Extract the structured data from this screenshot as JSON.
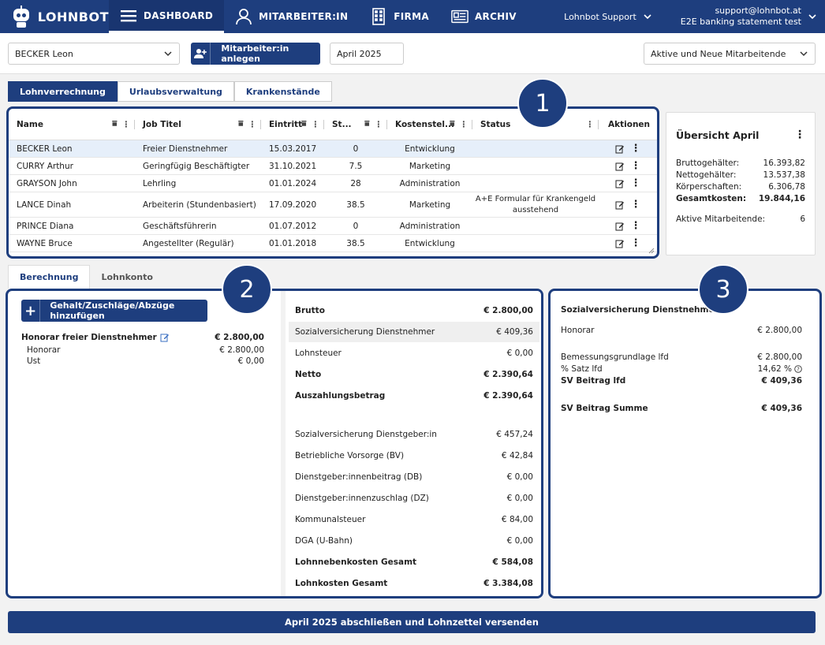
{
  "nav": {
    "logo": "LOHNBOT",
    "items": [
      {
        "label": "DASHBOARD",
        "icon": "menu-icon",
        "active": true
      },
      {
        "label": "MITARBEITER:IN",
        "icon": "user-icon",
        "active": false
      },
      {
        "label": "FIRMA",
        "icon": "building-icon",
        "active": false
      },
      {
        "label": "ARCHIV",
        "icon": "archive-icon",
        "active": false
      }
    ],
    "support": "Lohnbot Support",
    "account_email": "support@lohnbot.at",
    "account_name": "E2E banking statement test"
  },
  "toolbar": {
    "employee_select": "BECKER Leon",
    "add_employee": "Mitarbeiter:in anlegen",
    "month": "April 2025",
    "filter": "Aktive und Neue Mitarbeitende"
  },
  "tabs_top": [
    "Lohnverrechnung",
    "Urlaubsverwaltung",
    "Krankenstände"
  ],
  "table": {
    "headers": [
      "Name",
      "Job Titel",
      "Eintritt",
      "St...",
      "Kostenstel...",
      "Status",
      "Aktionen"
    ],
    "rows": [
      {
        "name": "BECKER Leon",
        "job": "Freier Dienstnehmer",
        "eintritt": "15.03.2017",
        "st": "0",
        "kst": "Entwicklung",
        "status": ""
      },
      {
        "name": "CURRY Arthur",
        "job": "Geringfügig Beschäftigter",
        "eintritt": "31.10.2021",
        "st": "7.5",
        "kst": "Marketing",
        "status": ""
      },
      {
        "name": "GRAYSON John",
        "job": "Lehrling",
        "eintritt": "01.01.2024",
        "st": "28",
        "kst": "Administration",
        "status": ""
      },
      {
        "name": "LANCE Dinah",
        "job": "Arbeiterin (Stundenbasiert)",
        "eintritt": "17.09.2020",
        "st": "38.5",
        "kst": "Marketing",
        "status": "A+E Formular für Krankengeld ausstehend"
      },
      {
        "name": "PRINCE Diana",
        "job": "Geschäftsführerin",
        "eintritt": "01.07.2012",
        "st": "0",
        "kst": "Administration",
        "status": ""
      },
      {
        "name": "WAYNE Bruce",
        "job": "Angestellter (Regulär)",
        "eintritt": "01.01.2018",
        "st": "38.5",
        "kst": "Entwicklung",
        "status": ""
      }
    ]
  },
  "overview": {
    "title": "Übersicht April",
    "brutto_label": "Bruttogehälter:",
    "brutto": "16.393,82",
    "netto_label": "Nettogehälter:",
    "netto": "13.537,38",
    "koerper_label": "Körperschaften:",
    "koerper": "6.306,78",
    "gesamt_label": "Gesamtkosten:",
    "gesamt": "19.844,16",
    "aktive_label": "Aktive Mitarbeitende:",
    "aktive": "6"
  },
  "tabs_bottom": [
    "Berechnung",
    "Lohnkonto"
  ],
  "calc": {
    "add_button": "Gehalt/Zuschläge/Abzüge hinzufügen",
    "honorar_title": "Honorar freier Dienstnehmer",
    "honorar_total": "€ 2.800,00",
    "honorar_label": "Honorar",
    "honorar_value": "€ 2.800,00",
    "ust_label": "Ust",
    "ust_value": "€ 0,00"
  },
  "summary": [
    {
      "label": "Brutto",
      "value": "€ 2.800,00",
      "bold": true
    },
    {
      "label": "Sozialversicherung Dienstnehmer",
      "value": "€ 409,36",
      "hl": true
    },
    {
      "label": "Lohnsteuer",
      "value": "€ 0,00"
    },
    {
      "label": "Netto",
      "value": "€ 2.390,64",
      "bold": true
    },
    {
      "label": "Auszahlungsbetrag",
      "value": "€ 2.390,64",
      "bold": true
    },
    {
      "label": "Sozialversicherung Dienstgeber:in",
      "value": "€ 457,24"
    },
    {
      "label": "Betriebliche Vorsorge (BV)",
      "value": "€ 42,84"
    },
    {
      "label": "Dienstgeber:innenbeitrag (DB)",
      "value": "€ 0,00"
    },
    {
      "label": "Dienstgeber:innenzuschlag (DZ)",
      "value": "€ 0,00"
    },
    {
      "label": "Kommunalsteuer",
      "value": "€ 84,00"
    },
    {
      "label": "DGA (U-Bahn)",
      "value": "€ 0,00"
    },
    {
      "label": "Lohnnebenkosten Gesamt",
      "value": "€ 584,08",
      "bold": true
    },
    {
      "label": "Lohnkosten Gesamt",
      "value": "€ 3.384,08",
      "bold": true
    }
  ],
  "sv": {
    "title": "Sozialversicherung Dienstnehmer",
    "honorar_label": "Honorar",
    "honorar": "€ 2.800,00",
    "bem_label": "Bemessungsgrundlage lfd",
    "bem": "€ 2.800,00",
    "satz_label": "% Satz lfd",
    "satz": "14,62 %",
    "beitrag_label": "SV Beitrag lfd",
    "beitrag": "€ 409,36",
    "summe_label": "SV Beitrag Summe",
    "summe": "€ 409,36"
  },
  "badges": [
    "1",
    "2",
    "3"
  ],
  "footer": {
    "button": "April 2025 abschließen und Lohnzettel versenden"
  }
}
